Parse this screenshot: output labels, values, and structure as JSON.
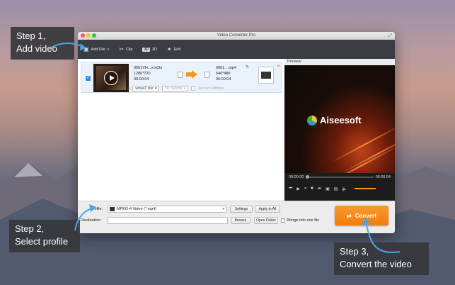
{
  "window": {
    "title": "Video Converter Pro"
  },
  "toolbar": {
    "add_file": "Add File",
    "clip": "Clip",
    "three_d": "3D",
    "three_d_label": "3D",
    "edit": "Edit"
  },
  "file": {
    "src_name": "0001VH...y.m2ts",
    "src_res": "1280*720",
    "src_dur": "00:00:04",
    "dst_name": "0001....mp4",
    "dst_res": "640*480",
    "dst_dur": "00:00:04",
    "audio": "wmav2 ster",
    "subtitle": "No Subtitle",
    "forced": "Forced Subtitles"
  },
  "preview": {
    "label": "Preview",
    "brand": "Aiseesoft",
    "time_start": "00:00:00",
    "time_end": "00:00:04"
  },
  "bottom": {
    "profile_label": "Profile:",
    "profile_value": "MPEG-4 Video (*.mp4)",
    "settings": "Settings",
    "apply_all": "Apply to All",
    "dest_label": "Destination:",
    "browse": "Browse",
    "open_folder": "Open Folder",
    "merge": "Merge into one file",
    "convert": "Convert"
  },
  "callouts": {
    "step1_a": "Step 1,",
    "step1_b": "Add video",
    "step2_a": "Step 2,",
    "step2_b": "Select profile",
    "step3_a": "Step 3,",
    "step3_b": "Convert the video"
  },
  "colors": {
    "accent": "#f39a1e",
    "callout_bg": "#37373c",
    "checkbox_blue": "#2f88e6"
  }
}
